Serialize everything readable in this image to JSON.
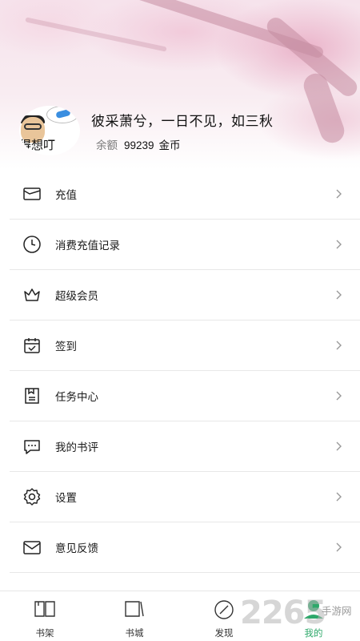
{
  "profile": {
    "avatar_caption": "得想叮",
    "username": "彼采萧兮，一日不见，如三秋",
    "balance_label": "余额",
    "balance_amount": "99239",
    "balance_unit": "金币"
  },
  "menu": {
    "items": [
      {
        "label": "充值",
        "icon": "wallet-icon"
      },
      {
        "label": "消费充值记录",
        "icon": "clock-icon"
      },
      {
        "label": "超级会员",
        "icon": "crown-icon"
      },
      {
        "label": "签到",
        "icon": "calendar-check-icon"
      },
      {
        "label": "任务中心",
        "icon": "task-icon"
      },
      {
        "label": "我的书评",
        "icon": "comment-icon"
      },
      {
        "label": "设置",
        "icon": "gear-icon"
      },
      {
        "label": "意见反馈",
        "icon": "mail-icon"
      }
    ]
  },
  "tabbar": {
    "tabs": [
      {
        "label": "书架",
        "icon": "bookshelf-icon",
        "active": false
      },
      {
        "label": "书城",
        "icon": "bookstore-icon",
        "active": false
      },
      {
        "label": "发现",
        "icon": "compass-icon",
        "active": false
      },
      {
        "label": "我的",
        "icon": "profile-icon",
        "active": true
      }
    ],
    "active_color": "#2da86a"
  },
  "watermark": {
    "number": "2265",
    "text": "手游网"
  }
}
